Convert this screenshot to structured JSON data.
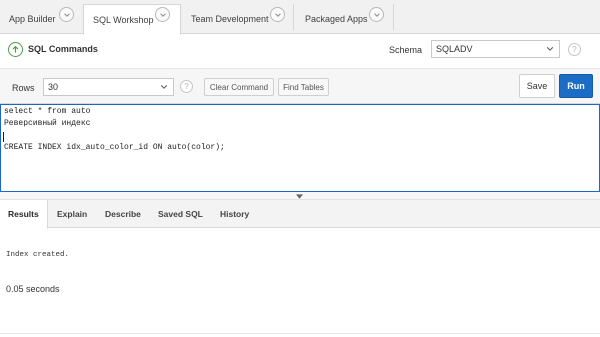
{
  "tabs": [
    {
      "label": "App Builder"
    },
    {
      "label": "SQL Workshop"
    },
    {
      "label": "Team Development"
    },
    {
      "label": "Packaged Apps"
    }
  ],
  "header": {
    "title": "SQL Commands",
    "schema_label": "Schema",
    "schema_value": "SQLADV",
    "help": "?"
  },
  "toolbar": {
    "rows_label": "Rows",
    "rows_value": "30",
    "help": "?",
    "clear_command": "Clear Command",
    "find_tables": "Find Tables",
    "save": "Save",
    "run": "Run"
  },
  "editor": {
    "lines": [
      "select * from auto",
      "Реверсивный индекс",
      "",
      "CREATE INDEX idx_auto_color_id ON auto(color);"
    ]
  },
  "results": {
    "tabs": [
      {
        "label": "Results"
      },
      {
        "label": "Explain"
      },
      {
        "label": "Describe"
      },
      {
        "label": "Saved SQL"
      },
      {
        "label": "History"
      }
    ],
    "message": "Index created.",
    "timing": "0.05 seconds"
  },
  "colors": {
    "accent": "#1b6cc4",
    "icon_green": "#4a9e47"
  }
}
